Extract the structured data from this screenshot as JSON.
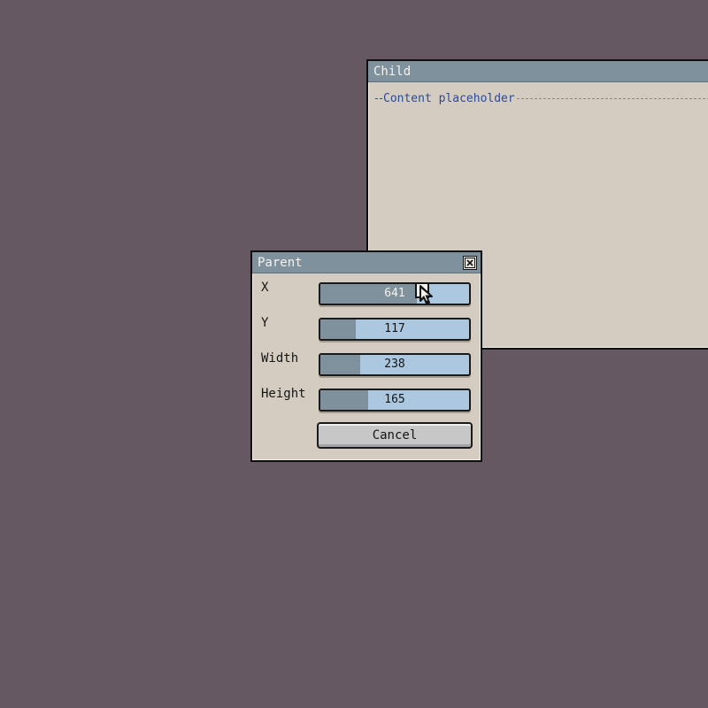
{
  "child_window": {
    "title": "Child",
    "content_placeholder": "Content placeholder"
  },
  "parent_window": {
    "title": "Parent",
    "fields": [
      {
        "label": "X",
        "value": "641",
        "fill_fraction": 0.65
      },
      {
        "label": "Y",
        "value": "117",
        "fill_fraction": 0.24
      },
      {
        "label": "Width",
        "value": "238",
        "fill_fraction": 0.27
      },
      {
        "label": "Height",
        "value": "165",
        "fill_fraction": 0.32
      }
    ],
    "cancel_label": "Cancel"
  },
  "icons": {
    "close": "close-icon",
    "cursor": "mouse-pointer-icon"
  },
  "colors": {
    "desktop": "#655862",
    "window_bg": "#d4ccc0",
    "titlebar": "#7f919d",
    "slider_fill": "#7f919d",
    "slider_track": "#acc8e0",
    "placeholder_text": "#2c4a9a"
  }
}
